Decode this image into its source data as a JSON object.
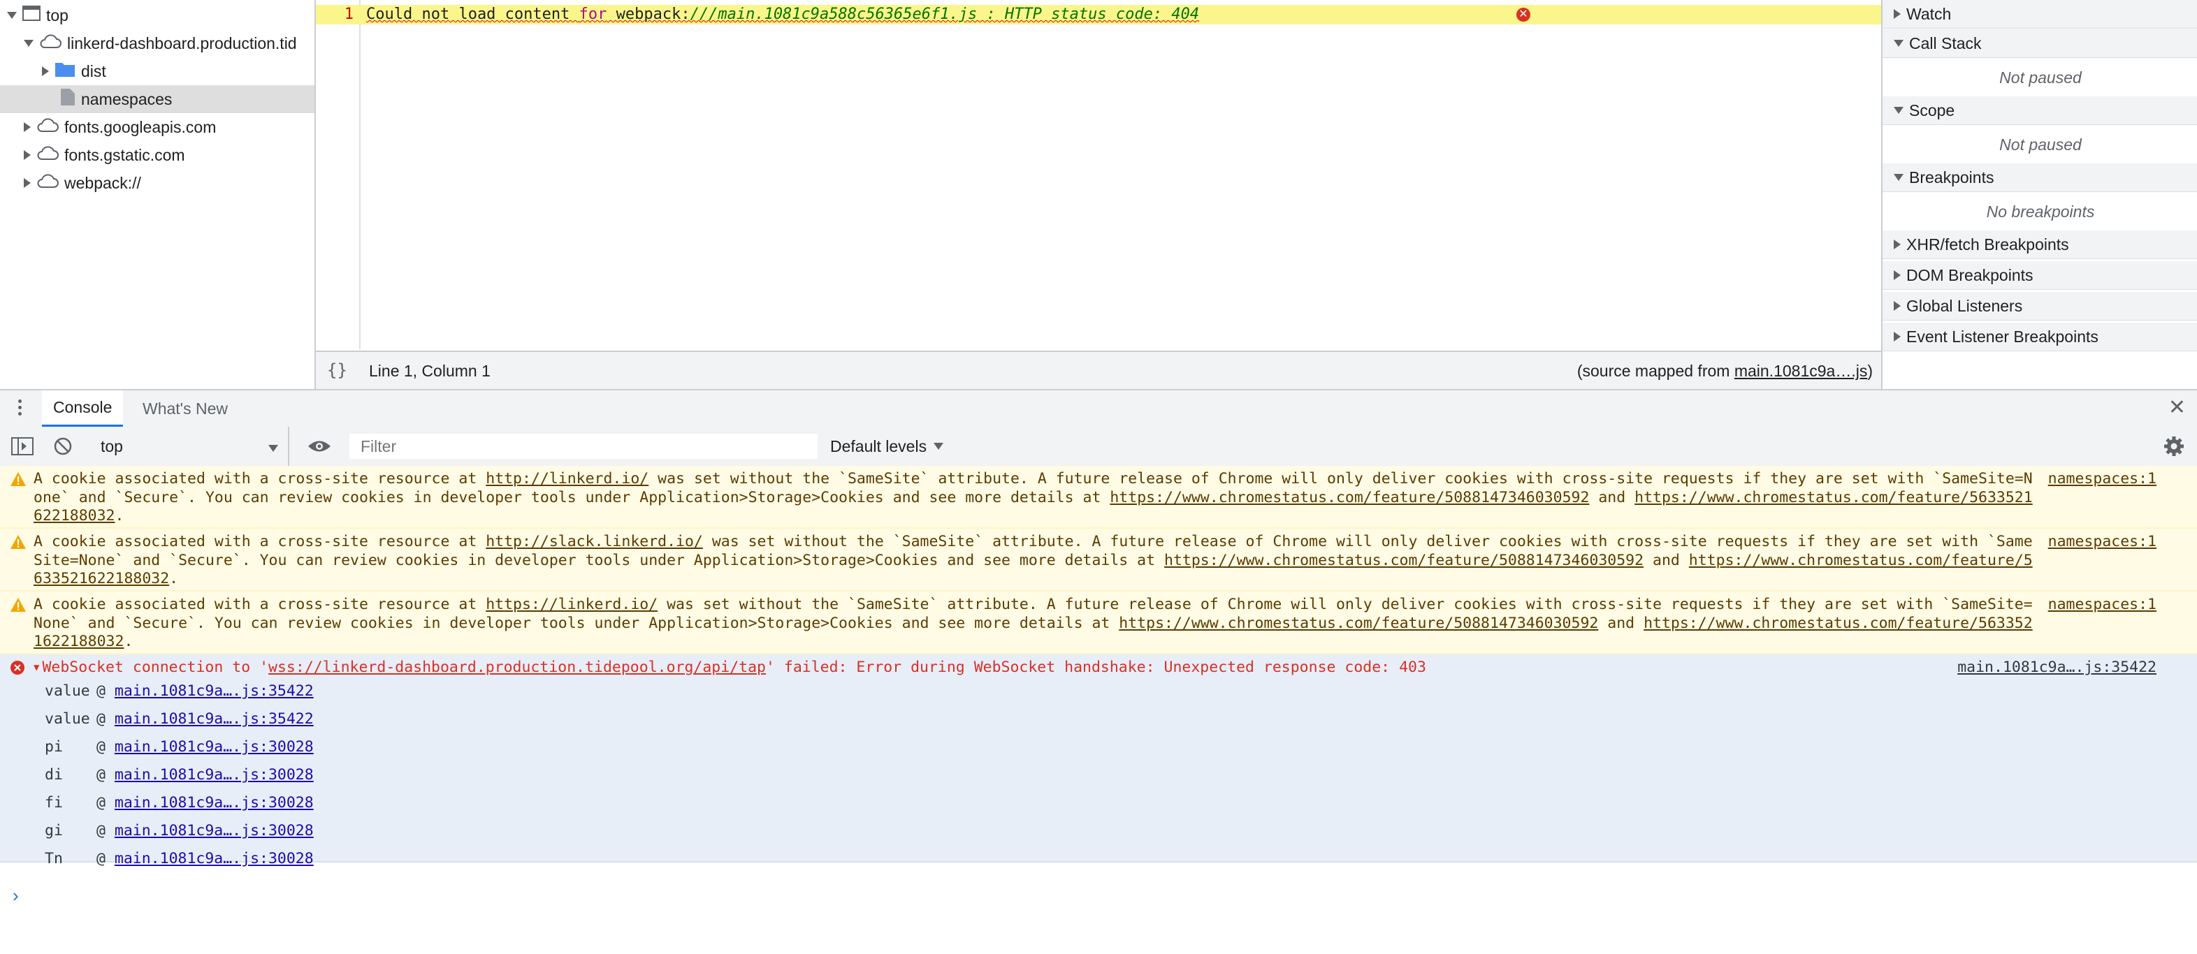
{
  "colors": {
    "accent": "#1a73e8",
    "warning_bg": "#fffbe5",
    "warning_text": "#5c3c00",
    "error_text": "#d93025",
    "highlight_line": "#fbf68b"
  },
  "navigator": {
    "items": [
      {
        "label": "top",
        "icon": "frame-icon",
        "expanded": true
      },
      {
        "label": "linkerd-dashboard.production.tid",
        "icon": "cloud-icon",
        "expanded": true
      },
      {
        "label": "dist",
        "icon": "folder-icon",
        "expanded": false
      },
      {
        "label": "namespaces",
        "icon": "file-icon",
        "selected": true
      },
      {
        "label": "fonts.googleapis.com",
        "icon": "cloud-icon",
        "expanded": false
      },
      {
        "label": "fonts.gstatic.com",
        "icon": "cloud-icon",
        "expanded": false
      },
      {
        "label": "webpack://",
        "icon": "cloud-icon",
        "expanded": false
      }
    ]
  },
  "editor": {
    "line_number": "1",
    "code_prefix": "Could not load content ",
    "code_keyword": "for",
    "code_middle": " webpack:",
    "code_string": "///main.1081c9a588c56365e6f1.js : HTTP status code: 404",
    "status_braces": "{}",
    "status_position": "Line 1, Column 1",
    "source_prefix": "(source mapped from ",
    "source_link": "main.1081c9a….js",
    "source_suffix": ")"
  },
  "debugger_sidebar": {
    "watch": "Watch",
    "call_stack": "Call Stack",
    "call_stack_body": "Not paused",
    "scope": "Scope",
    "scope_body": "Not paused",
    "breakpoints": "Breakpoints",
    "breakpoints_body": "No breakpoints",
    "xhr": "XHR/fetch Breakpoints",
    "dom": "DOM Breakpoints",
    "global": "Global Listeners",
    "event": "Event Listener Breakpoints"
  },
  "drawer": {
    "tab_console": "Console",
    "tab_whats_new": "What's New",
    "close": "✕"
  },
  "toolbar": {
    "context": "top",
    "filter_placeholder": "Filter",
    "levels": "Default levels"
  },
  "messages": {
    "warnings": [
      {
        "pre": "A cookie associated with a cross-site resource at ",
        "url": "http://linkerd.io/",
        "source": "namespaces:1"
      },
      {
        "pre": "A cookie associated with a cross-site resource at ",
        "url": "http://slack.linkerd.io/",
        "source": "namespaces:1"
      },
      {
        "pre": "A cookie associated with a cross-site resource at ",
        "url": "https://linkerd.io/",
        "source": "namespaces:1"
      }
    ],
    "warning_mid": " was set without the `SameSite` attribute. A future release of Chrome will only deliver cookies with cross-site requests if they are set with `SameSite=None` and `Secure`. You can review cookies in developer tools under Application>Storage>Cookies and see more details at ",
    "warning_link1": "https://www.chromestatus.com/feature/5088147346030592",
    "warning_and": " and ",
    "warning_link2": "https://www.chromestatus.com/feature/5633521622188032",
    "warning_end": ".",
    "error": {
      "pre": "WebSocket connection to '",
      "url": "wss://linkerd-dashboard.production.tidepool.org/api/tap",
      "post": "' failed: Error during WebSocket handshake: Unexpected response code: 403",
      "source": "main.1081c9a….js:35422"
    },
    "stack": [
      {
        "fn": "value",
        "at": "@",
        "link": "main.1081c9a….js:35422"
      },
      {
        "fn": "value",
        "at": "@",
        "link": "main.1081c9a….js:35422"
      },
      {
        "fn": "pi",
        "at": "@",
        "link": "main.1081c9a….js:30028"
      },
      {
        "fn": "di",
        "at": "@",
        "link": "main.1081c9a….js:30028"
      },
      {
        "fn": "fi",
        "at": "@",
        "link": "main.1081c9a….js:30028"
      },
      {
        "fn": "gi",
        "at": "@",
        "link": "main.1081c9a….js:30028"
      },
      {
        "fn": "Tn",
        "at": "@",
        "link": "main.1081c9a….js:30028"
      }
    ],
    "prompt": "›"
  }
}
